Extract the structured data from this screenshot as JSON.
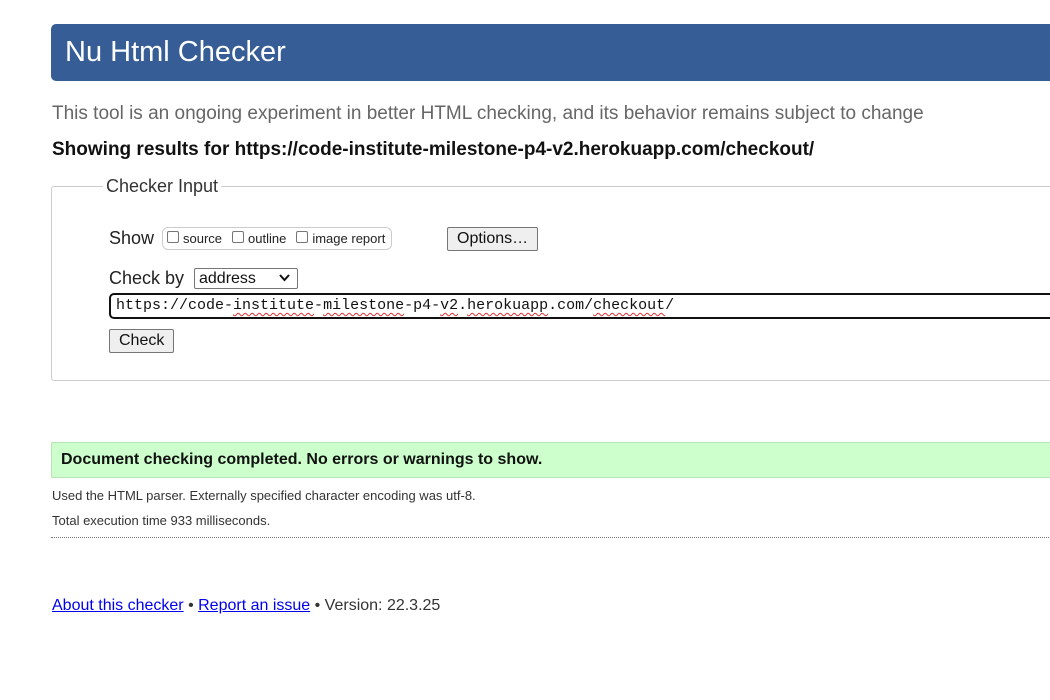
{
  "header": {
    "title": "Nu Html Checker",
    "bg_color": "#365d95"
  },
  "tagline": "This tool is an ongoing experiment in better HTML checking, and its behavior remains subject to change",
  "results_heading": "Showing results for https://code-institute-milestone-p4-v2.herokuapp.com/checkout/",
  "checker_input": {
    "legend": "Checker Input",
    "show_label": "Show",
    "show_options": [
      {
        "label": "source",
        "checked": false
      },
      {
        "label": "outline",
        "checked": false
      },
      {
        "label": "image report",
        "checked": false
      }
    ],
    "options_button": "Options…",
    "check_by_label": "Check by",
    "check_by_selected": "address",
    "url_value_parts": [
      "https://code-",
      "institute",
      "-",
      "milestone",
      "-p4-",
      "v2",
      ".",
      "herokuapp",
      ".com/",
      "checkout",
      "/"
    ],
    "check_button": "Check"
  },
  "result": {
    "message": "Document checking completed. No errors or warnings to show.",
    "bg_color": "#ccffcc",
    "parser_info": "Used the HTML parser. Externally specified character encoding was utf-8.",
    "execution_time": "Total execution time 933 milliseconds."
  },
  "footer": {
    "about_link": "About this checker",
    "separator": " • ",
    "report_link": "Report an issue",
    "version": " • Version: 22.3.25"
  }
}
